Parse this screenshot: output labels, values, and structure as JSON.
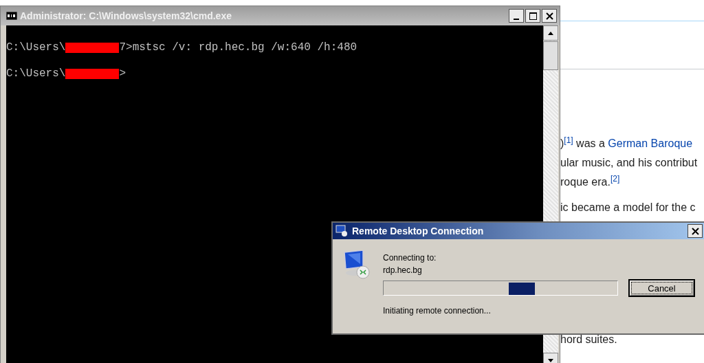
{
  "browser_page": {
    "lines": [
      {
        "segments": [
          {
            "kind": "text",
            "text": ")"
          },
          {
            "kind": "ref",
            "text": "[1]"
          },
          {
            "kind": "text",
            "text": " was a "
          },
          {
            "kind": "link",
            "text": "German Baroque"
          }
        ]
      },
      {
        "segments": [
          {
            "kind": "text",
            "text": "ular music, and his contribut"
          }
        ]
      },
      {
        "segments": [
          {
            "kind": "text",
            "text": "roque era."
          },
          {
            "kind": "ref",
            "text": "[2]"
          }
        ]
      },
      {
        "segments": [
          {
            "kind": "text",
            "text": "ic became a model for the c"
          }
        ]
      },
      {
        "segments": [
          {
            "kind": "text",
            "text": "hord suites."
          }
        ]
      }
    ]
  },
  "console_window": {
    "title": "Administrator: C:\\Windows\\system32\\cmd.exe",
    "active": false,
    "lines": [
      {
        "prompt": "C:\\Users\\",
        "redacted": true,
        "command": "7>mstsc /v: rdp.hec.bg /w:640 /h:480"
      },
      {
        "prompt": "C:\\Users\\",
        "redacted": true,
        "command": ">"
      }
    ]
  },
  "dialog": {
    "title": "Remote Desktop Connection",
    "label": "Connecting to:",
    "host": "rdp.hec.bg",
    "status": "Initiating remote connection...",
    "progress": {
      "indeterminate": true
    },
    "buttons": [
      "Cancel"
    ]
  }
}
